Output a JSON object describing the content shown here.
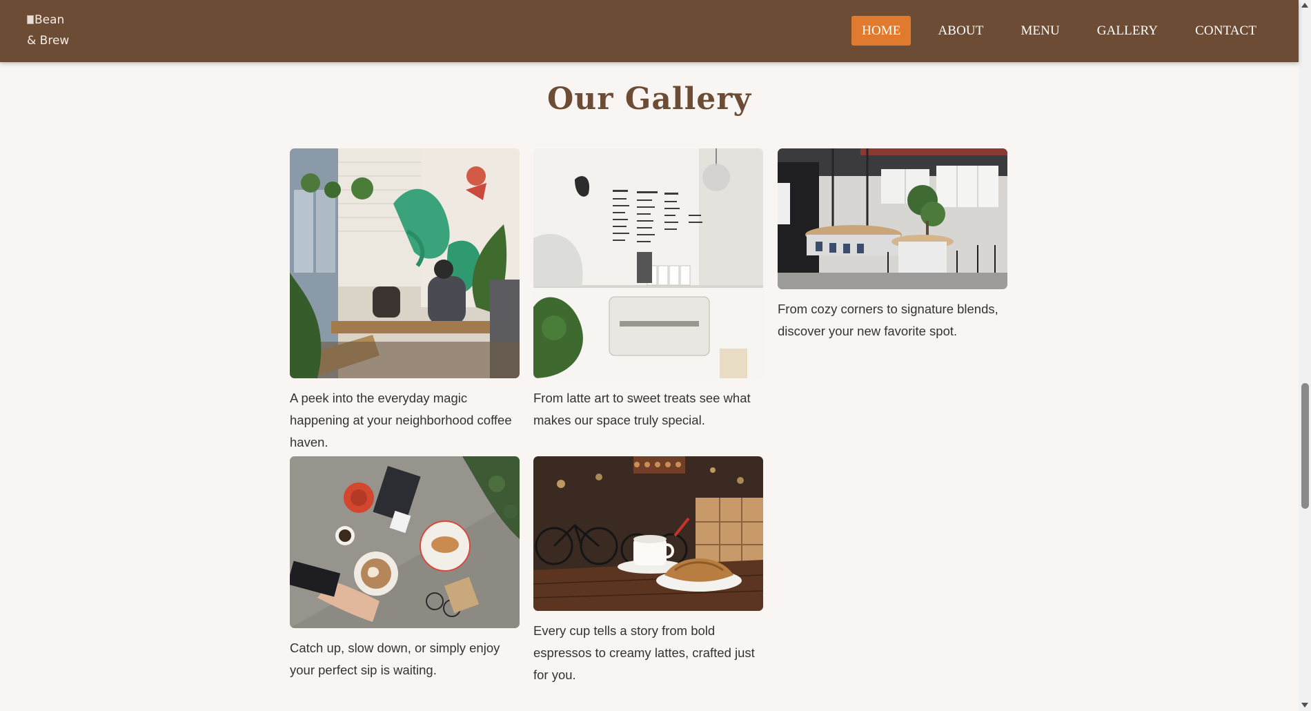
{
  "logo": {
    "alt_text": "Bean & Brew"
  },
  "nav": {
    "items": [
      {
        "label": "HOME",
        "active": true
      },
      {
        "label": "ABOUT",
        "active": false
      },
      {
        "label": "MENU",
        "active": false
      },
      {
        "label": "GALLERY",
        "active": false
      },
      {
        "label": "CONTACT",
        "active": false
      }
    ]
  },
  "gallery": {
    "title": "Our Gallery",
    "items": [
      {
        "image": "cafe-interior-mural-photo",
        "caption": "A peek into the everyday magic happening at your neighborhood coffee haven."
      },
      {
        "image": "espresso-bar-menu-board-photo",
        "caption": "From latte art to sweet treats see what makes our space truly special."
      },
      {
        "image": "industrial-cafe-interior-photo",
        "caption": "From cozy corners to signature blends, discover your new favorite spot."
      },
      {
        "image": "latte-and-pastry-flatlay-photo",
        "caption": "Catch up, slow down, or simply enjoy your perfect sip is waiting."
      },
      {
        "image": "coffee-cup-and-croissant-photo",
        "caption": "Every cup tells a story from bold espressos to creamy lattes, crafted just for you."
      }
    ]
  },
  "colors": {
    "header_bg": "#6d4c35",
    "accent": "#e07a2e",
    "page_bg": "#f8f5f2",
    "title": "#6d4c35",
    "text": "#333333"
  }
}
